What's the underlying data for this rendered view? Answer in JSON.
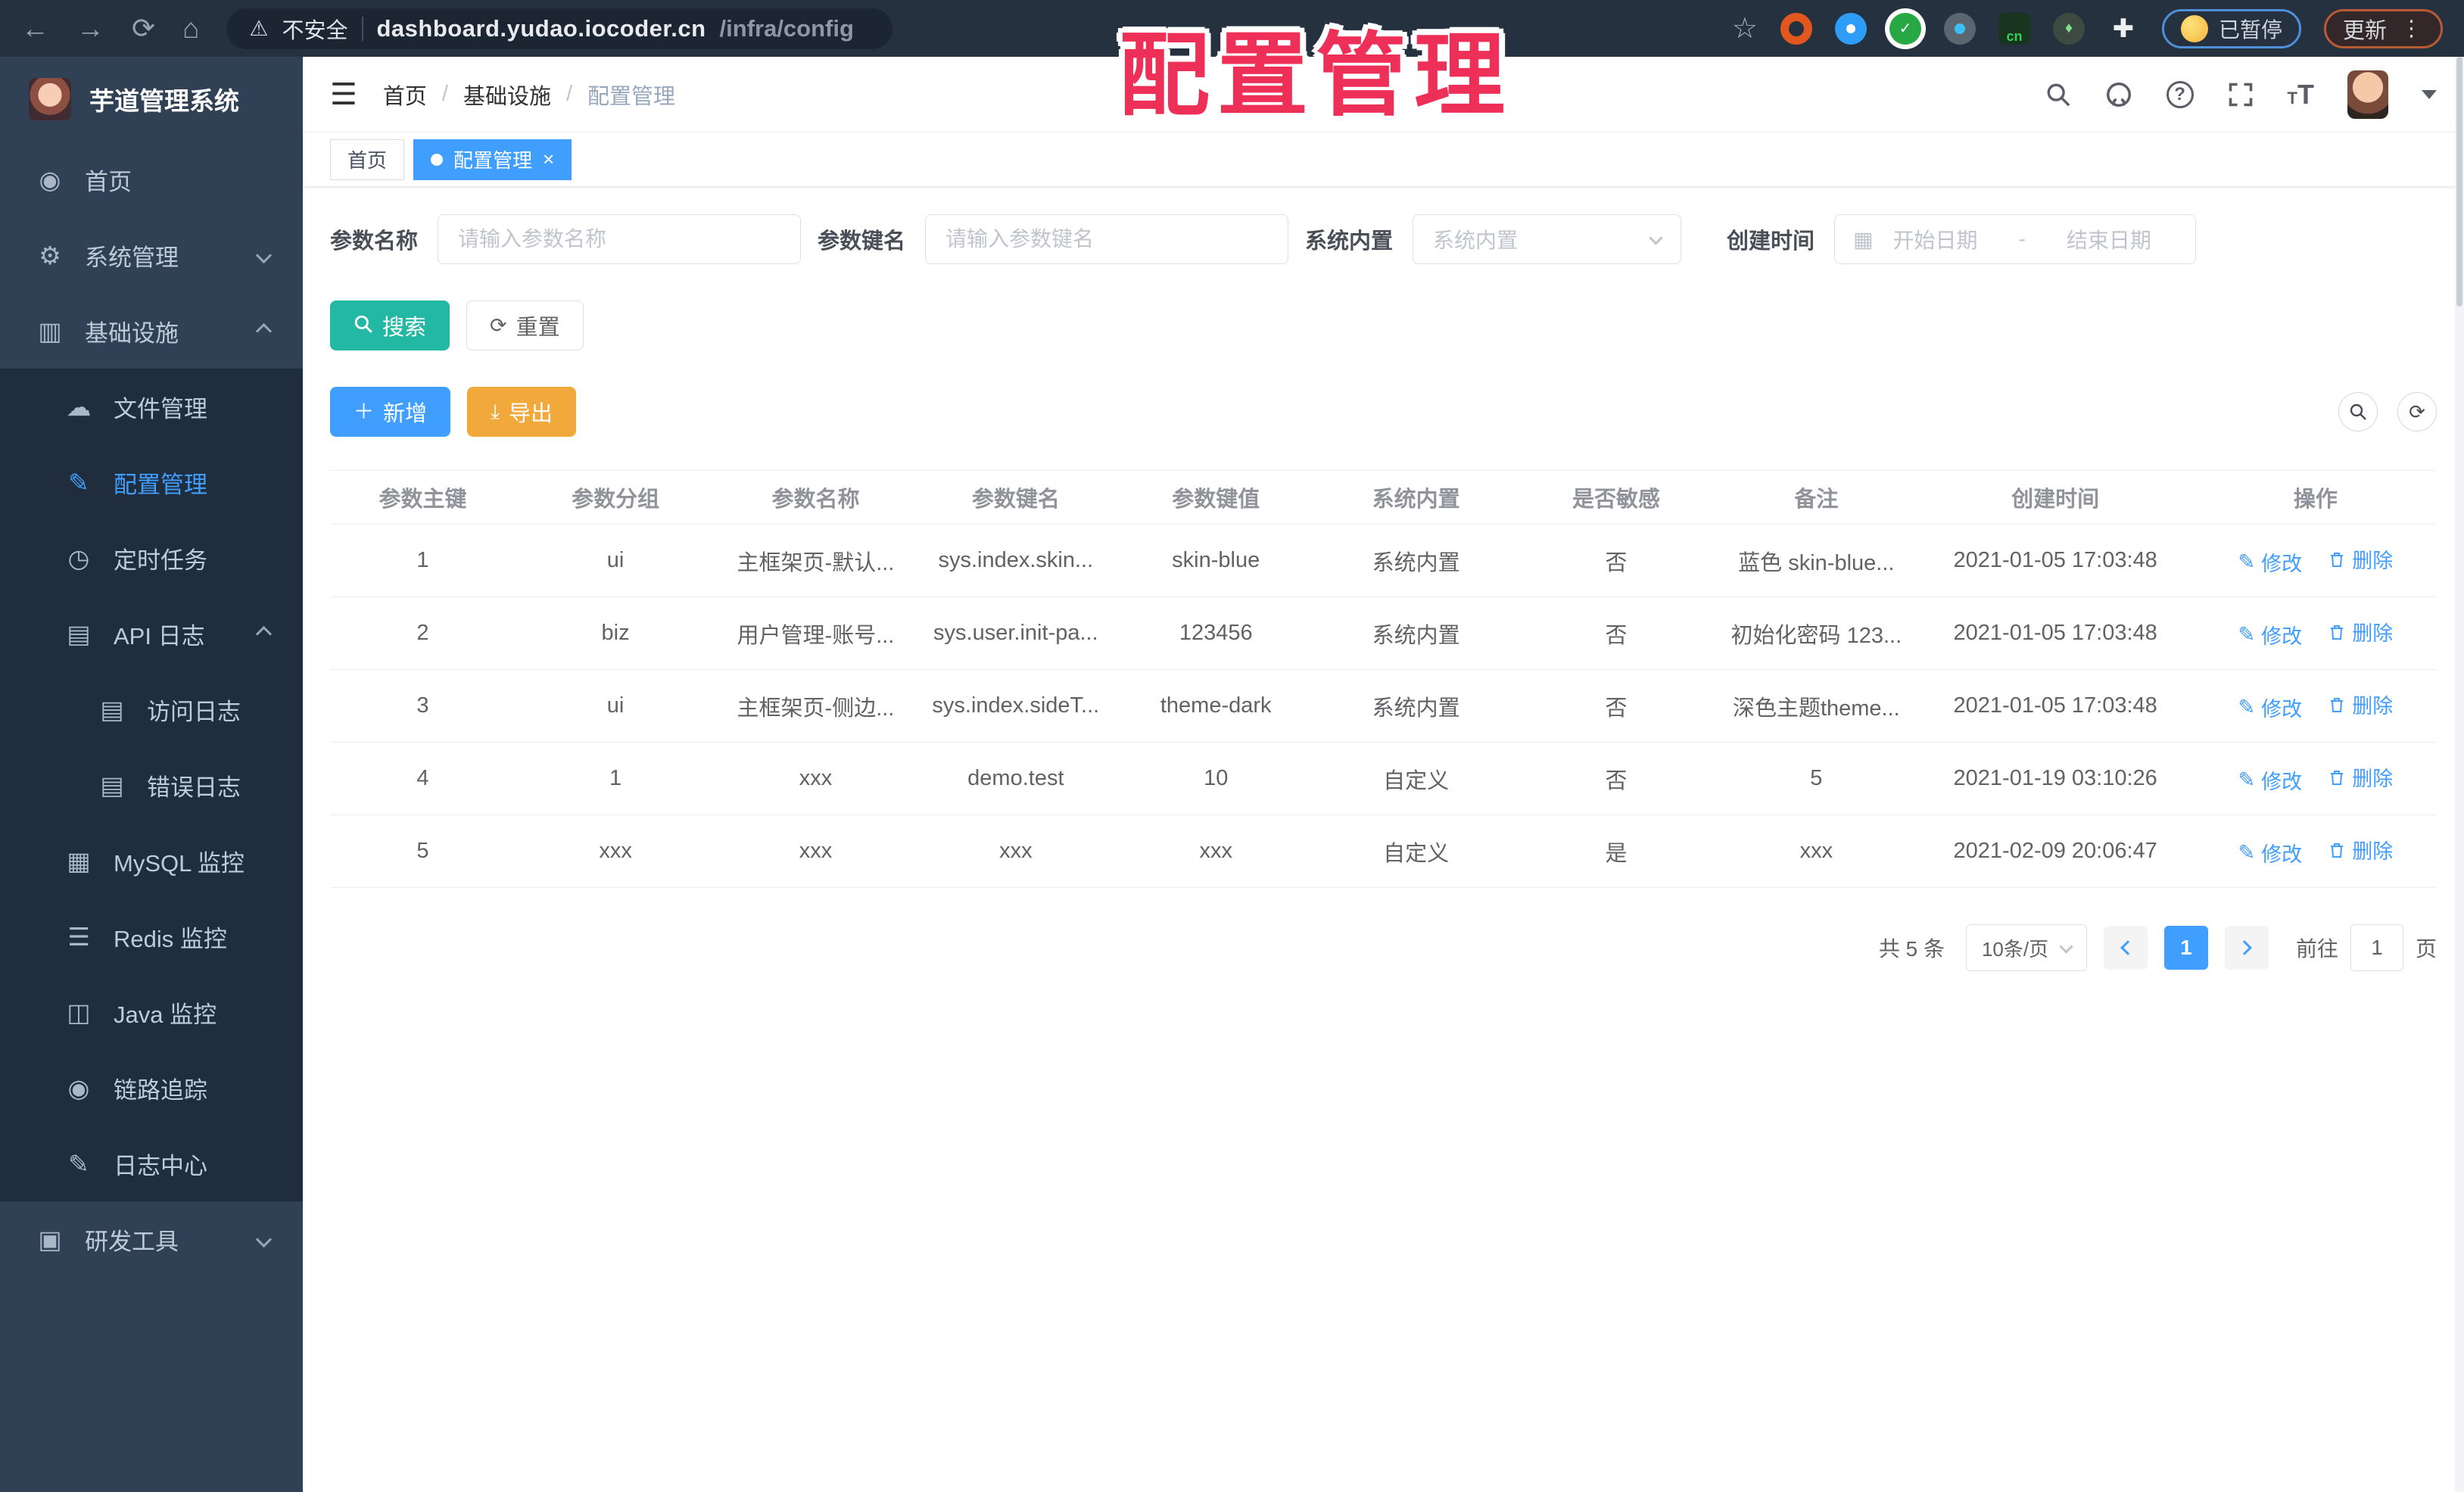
{
  "browser": {
    "security": "不安全",
    "host": "dashboard.yudao.iocoder.cn",
    "path": "/infra/config",
    "paused_badge": "已暂停",
    "update_label": "更新"
  },
  "overlay": {
    "title": "配置管理"
  },
  "colors": {
    "accent": "#409eff",
    "sidebar_bg": "#304156",
    "submenu_bg": "#1f2d3d",
    "search_btn": "#23b8a4",
    "export_btn": "#f2a93c",
    "overlay_red": "#ee3058"
  },
  "sidebar": {
    "app_title": "芋道管理系统",
    "home": "首页",
    "system": "系统管理",
    "infra": "基础设施",
    "file": "文件管理",
    "config": "配置管理",
    "job": "定时任务",
    "apilog": "API 日志",
    "accesslog": "访问日志",
    "errorlog": "错误日志",
    "mysql": "MySQL 监控",
    "redis": "Redis 监控",
    "java": "Java 监控",
    "trace": "链路追踪",
    "logcenter": "日志中心",
    "devtool": "研发工具"
  },
  "header": {
    "breadcrumb": [
      "首页",
      "基础设施",
      "配置管理"
    ]
  },
  "tabs": {
    "home": "首页",
    "active": "配置管理"
  },
  "filters": {
    "name_label": "参数名称",
    "name_placeholder": "请输入参数名称",
    "key_label": "参数键名",
    "key_placeholder": "请输入参数键名",
    "type_label": "系统内置",
    "type_placeholder": "系统内置",
    "date_label": "创建时间",
    "date_start": "开始日期",
    "date_sep": "-",
    "date_end": "结束日期"
  },
  "actions": {
    "search": "搜索",
    "reset": "重置",
    "add": "新增",
    "export": "导出"
  },
  "table": {
    "headers": [
      "参数主键",
      "参数分组",
      "参数名称",
      "参数键名",
      "参数键值",
      "系统内置",
      "是否敏感",
      "备注",
      "创建时间",
      "操作"
    ],
    "edit": "修改",
    "delete": "删除",
    "rows": [
      [
        "1",
        "ui",
        "主框架页-默认...",
        "sys.index.skin...",
        "skin-blue",
        "系统内置",
        "否",
        "蓝色 skin-blue...",
        "2021-01-05 17:03:48"
      ],
      [
        "2",
        "biz",
        "用户管理-账号...",
        "sys.user.init-pa...",
        "123456",
        "系统内置",
        "否",
        "初始化密码 123...",
        "2021-01-05 17:03:48"
      ],
      [
        "3",
        "ui",
        "主框架页-侧边...",
        "sys.index.sideT...",
        "theme-dark",
        "系统内置",
        "否",
        "深色主题theme...",
        "2021-01-05 17:03:48"
      ],
      [
        "4",
        "1",
        "xxx",
        "demo.test",
        "10",
        "自定义",
        "否",
        "5",
        "2021-01-19 03:10:26"
      ],
      [
        "5",
        "xxx",
        "xxx",
        "xxx",
        "xxx",
        "自定义",
        "是",
        "xxx",
        "2021-02-09 20:06:47"
      ]
    ]
  },
  "pagination": {
    "total": "共 5 条",
    "page_size": "10条/页",
    "current": "1",
    "goto_label": "前往",
    "goto_value": "1",
    "unit": "页"
  }
}
